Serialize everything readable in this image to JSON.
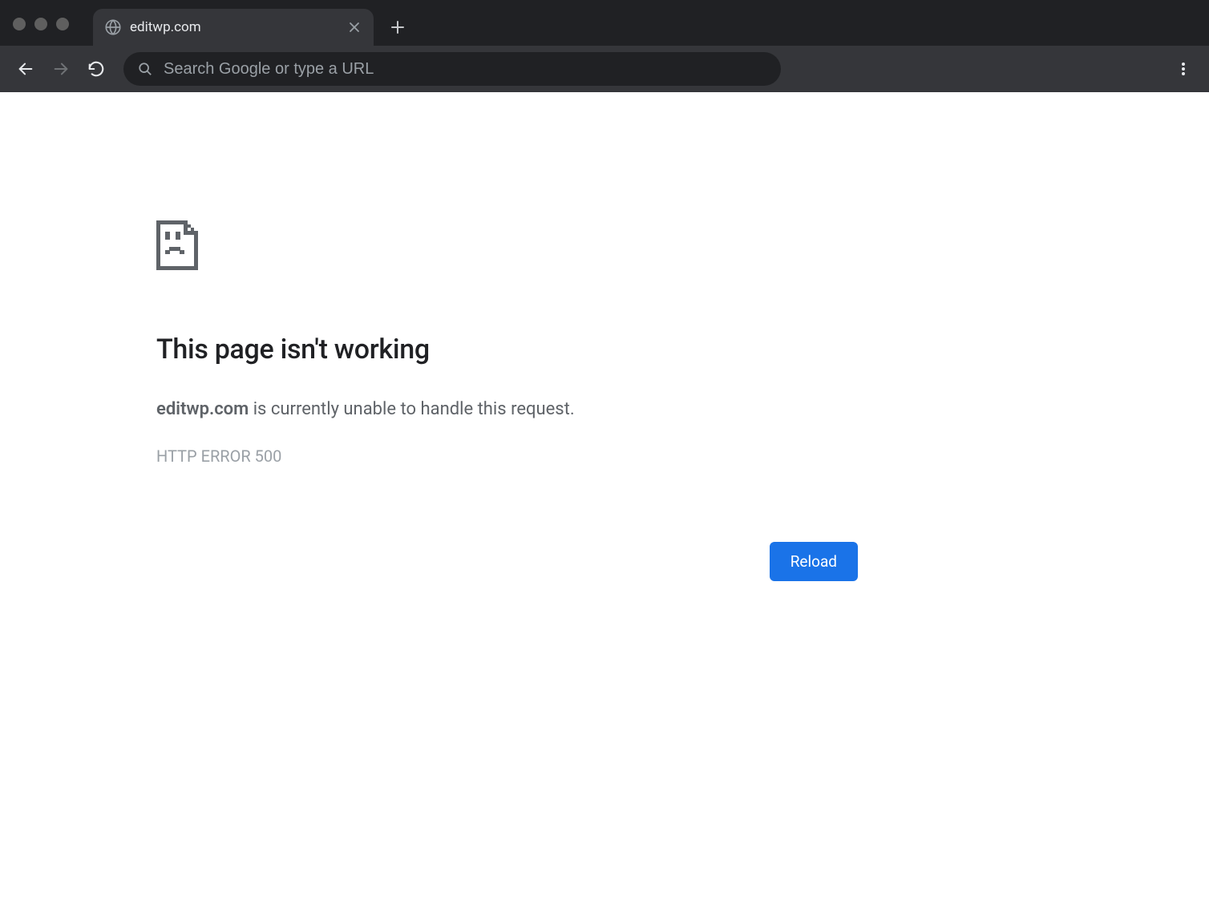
{
  "browser": {
    "tab": {
      "title": "editwp.com"
    },
    "address_bar": {
      "placeholder": "Search Google or type a URL",
      "value": ""
    }
  },
  "error": {
    "title": "This page isn't working",
    "domain": "editwp.com",
    "message_suffix": " is currently unable to handle this request.",
    "code": "HTTP ERROR 500",
    "reload_label": "Reload"
  }
}
